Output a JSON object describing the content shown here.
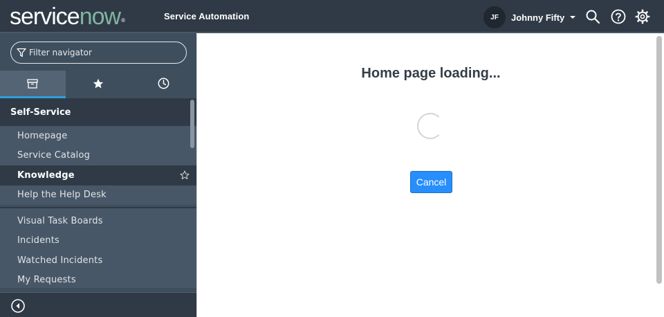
{
  "header": {
    "logo_service": "service",
    "logo_now": "now",
    "logo_reg": "®",
    "app_title": "Service Automation",
    "user_initials": "JF",
    "user_name": "Johnny Fifty",
    "icons": [
      "search-icon",
      "help-icon",
      "gear-icon"
    ]
  },
  "navigator": {
    "filter_placeholder": "Filter navigator",
    "tabs": [
      {
        "icon": "archive-icon",
        "active": true
      },
      {
        "icon": "star-icon",
        "active": false
      },
      {
        "icon": "clock-icon",
        "active": false
      }
    ],
    "section": "Self-Service",
    "items": [
      {
        "label": "Homepage"
      },
      {
        "label": "Service Catalog"
      },
      {
        "label": "Knowledge"
      },
      {
        "label": "Help the Help Desk"
      }
    ],
    "items2": [
      {
        "label": "Visual Task Boards"
      },
      {
        "label": "Incidents"
      },
      {
        "label": "Watched Incidents"
      },
      {
        "label": "My Requests"
      }
    ]
  },
  "main": {
    "loading_title": "Home page loading...",
    "cancel_label": "Cancel"
  },
  "colors": {
    "header_bg": "#303a46",
    "nav_bg": "#485767",
    "logo_accent": "#81b5a1",
    "active_tab_accent": "#2e9fd9",
    "cancel_button": "#278efc"
  }
}
